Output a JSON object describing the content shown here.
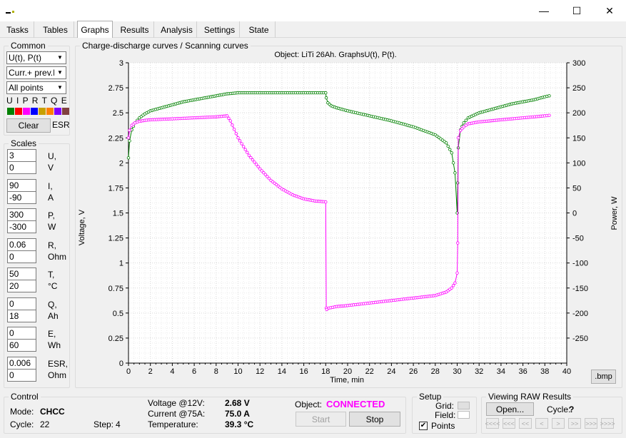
{
  "window": {
    "minimize": "—",
    "maximize": "☐",
    "close": "✕"
  },
  "tabs": [
    {
      "label": "Tasks"
    },
    {
      "label": "Tables"
    },
    {
      "label": "Graphs"
    },
    {
      "label": "Results"
    },
    {
      "label": "Analysis"
    },
    {
      "label": "Settings"
    },
    {
      "label": "State"
    }
  ],
  "common": {
    "legend": "Common",
    "graph_select": "U(t), P(t)",
    "curve_select": "Curr.+ prev.L",
    "points_select": "All points",
    "series_letters": "U I P R T Q E",
    "series_colors": [
      "#008000",
      "#ff0000",
      "#ff00ff",
      "#0000ff",
      "#c8a000",
      "#ff8000",
      "#8000ff",
      "#804040"
    ],
    "clear_label": "Clear",
    "esr_label": "ESR"
  },
  "scales": {
    "legend": "Scales",
    "rows": [
      {
        "max": "3",
        "min": "0",
        "name": "U,",
        "unit": "V"
      },
      {
        "max": "90",
        "min": "-90",
        "name": "I,",
        "unit": "A"
      },
      {
        "max": "300",
        "min": "-300",
        "name": "P,",
        "unit": "W"
      },
      {
        "max": "0.06",
        "min": "0",
        "name": "R,",
        "unit": "Ohm"
      },
      {
        "max": "50",
        "min": "20",
        "name": "T,",
        "unit": "°C"
      },
      {
        "max": "0",
        "min": "18",
        "name": "Q,",
        "unit": "Ah"
      },
      {
        "max": "0",
        "min": "60",
        "name": "E,",
        "unit": "Wh"
      },
      {
        "max": "0.006",
        "min": "0",
        "name": "ESR,",
        "unit": "Ohm"
      }
    ]
  },
  "graph": {
    "legend": "Charge-discharge curves / Scanning curves",
    "bmp_label": ".bmp"
  },
  "chart_data": {
    "type": "scatter",
    "title": "Object: LiTi 26Ah. GraphsU(t), P(t).",
    "xlabel": "Time, min",
    "ylabel": "Voltage, V",
    "y2label": "Power, W",
    "xlim": [
      0,
      40
    ],
    "ylim": [
      0,
      3
    ],
    "y2lim": [
      -300,
      300
    ],
    "xticks": [
      "0",
      "2",
      "4",
      "6",
      "8",
      "10",
      "12",
      "14",
      "16",
      "18",
      "20",
      "22",
      "24",
      "26",
      "28",
      "30",
      "32",
      "34",
      "36",
      "38",
      "40"
    ],
    "yticks": [
      "0",
      "0.25",
      "0.5",
      "0.75",
      "1",
      "1.25",
      "1.5",
      "1.75",
      "2",
      "2.25",
      "2.5",
      "2.75",
      "3"
    ],
    "y2ticks": [
      "-250",
      "-200",
      "-150",
      "-100",
      "-50",
      "0",
      "50",
      "100",
      "150",
      "200",
      "250",
      "300"
    ],
    "grid": true,
    "series": [
      {
        "color": "#008000",
        "axis": "left",
        "x": [
          0,
          0.1,
          0.3,
          0.6,
          1,
          1.5,
          2,
          3,
          4,
          5,
          6,
          7,
          8,
          9,
          10,
          12,
          14,
          16,
          18,
          18.05,
          18.2,
          18.5,
          19,
          20,
          22,
          24,
          26,
          28,
          29,
          29.5,
          29.8,
          30,
          30.05,
          30.1,
          30.3,
          30.6,
          31,
          32,
          33,
          34,
          35,
          36,
          37,
          38,
          38.4
        ],
        "y": [
          2.05,
          2.22,
          2.33,
          2.4,
          2.45,
          2.49,
          2.52,
          2.55,
          2.58,
          2.61,
          2.63,
          2.65,
          2.67,
          2.69,
          2.7,
          2.7,
          2.7,
          2.7,
          2.7,
          2.65,
          2.6,
          2.57,
          2.55,
          2.52,
          2.47,
          2.42,
          2.36,
          2.28,
          2.2,
          2.1,
          1.9,
          1.5,
          1.8,
          2.15,
          2.33,
          2.4,
          2.45,
          2.5,
          2.53,
          2.56,
          2.59,
          2.61,
          2.63,
          2.66,
          2.67
        ]
      },
      {
        "color": "#ff00ff",
        "axis": "right",
        "x": [
          0,
          0.1,
          0.3,
          0.6,
          1,
          1.5,
          2,
          4,
          6,
          8,
          9,
          9.3,
          10,
          11,
          12,
          13,
          14,
          15,
          16,
          17,
          18,
          18.05,
          18.1,
          18.3,
          19,
          20,
          22,
          24,
          26,
          28,
          29,
          29.5,
          29.8,
          30,
          30.05,
          30.1,
          30.3,
          30.6,
          31,
          32,
          34,
          36,
          38,
          38.4
        ],
        "y": [
          150,
          165,
          175,
          180,
          183,
          185,
          186,
          188,
          190,
          192,
          194,
          184,
          150,
          115,
          88,
          65,
          48,
          36,
          28,
          24,
          22,
          -190,
          -193,
          -190,
          -187,
          -185,
          -180,
          -175,
          -170,
          -165,
          -158,
          -150,
          -140,
          -120,
          -60,
          150,
          165,
          172,
          178,
          182,
          186,
          190,
          194,
          195
        ]
      }
    ]
  },
  "control": {
    "legend": "Control",
    "mode_label": "Mode:",
    "mode_value": "CHCC",
    "cycle_label": "Cycle:",
    "cycle_value": "22",
    "step_label": "Step:",
    "step_value": "4",
    "voltage_label": "Voltage @12V:",
    "voltage_value": "2.68 V",
    "current_label": "Current @75A:",
    "current_value": "75.0 A",
    "temp_label": "Temperature:",
    "temp_value": "39.3 °C",
    "object_label": "Object:",
    "object_value": "CONNECTED",
    "start_label": "Start",
    "stop_label": "Stop"
  },
  "setup": {
    "legend": "Setup",
    "grid_label": "Grid:",
    "field_label": "Field:",
    "points_label": "Points",
    "points_checked": "✔"
  },
  "raw": {
    "legend": "Viewing RAW Results",
    "open_label": "Open...",
    "cycle_label": "Cycle:",
    "cycle_value": "?",
    "nav": [
      "<<<<",
      "<<<",
      "<<",
      "<",
      ">",
      ">>",
      ">>>",
      ">>>>"
    ]
  }
}
